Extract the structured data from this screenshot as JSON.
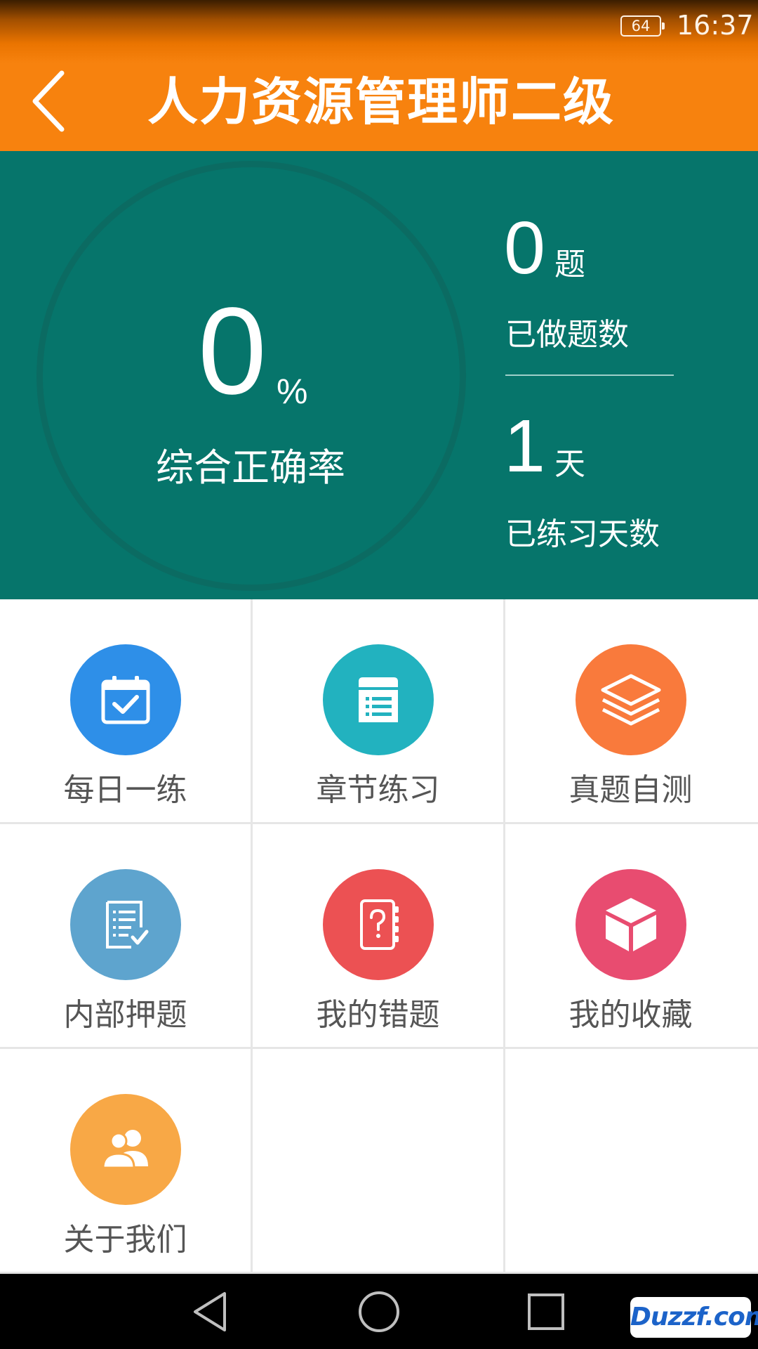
{
  "status_bar": {
    "battery": "64",
    "time": "16:37"
  },
  "app_bar": {
    "title": "人力资源管理师二级",
    "back_icon": "chevron-left-icon"
  },
  "stats": {
    "accuracy": {
      "value": "0",
      "unit": "%",
      "label": "综合正确率"
    },
    "questions_done": {
      "value": "0",
      "unit": "题",
      "label": "已做题数"
    },
    "practice_days": {
      "value": "1",
      "unit": "天",
      "label": "已练习天数"
    }
  },
  "menu": [
    {
      "label": "每日一练",
      "icon": "calendar-check-icon",
      "color": "#2e8fe8"
    },
    {
      "label": "章节练习",
      "icon": "document-list-icon",
      "color": "#22b2bf"
    },
    {
      "label": "真题自测",
      "icon": "layers-icon",
      "color": "#f97a3c"
    },
    {
      "label": "内部押题",
      "icon": "checklist-icon",
      "color": "#5ea4ce"
    },
    {
      "label": "我的错题",
      "icon": "question-book-icon",
      "color": "#ec5153"
    },
    {
      "label": "我的收藏",
      "icon": "box-icon",
      "color": "#e84c70"
    },
    {
      "label": "关于我们",
      "icon": "users-icon",
      "color": "#f8a846"
    }
  ],
  "navbar": {
    "back_icon": "back-triangle-icon",
    "home_icon": "home-circle-icon",
    "recents_icon": "recents-square-icon"
  },
  "watermark": {
    "text": "Duzzf.com"
  },
  "colors": {
    "app_bar": "#f7820e",
    "stats_bg": "#06756b"
  }
}
